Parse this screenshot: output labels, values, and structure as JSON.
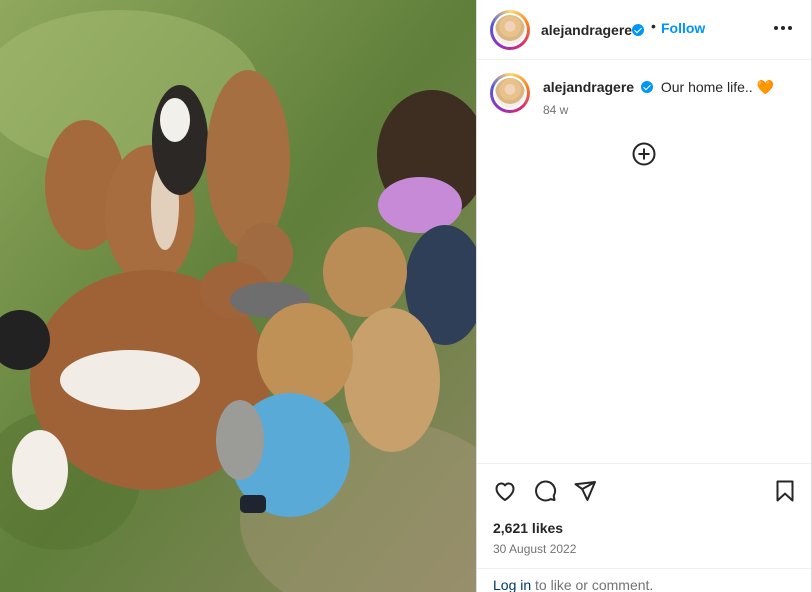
{
  "post": {
    "username": "alejandragere",
    "verified": true,
    "follow_label": "Follow",
    "separator": "•",
    "caption_text": "Our home life..",
    "caption_emoji": "🧡",
    "age": "84 w",
    "likes": "2,621 likes",
    "date": "30 August 2022"
  },
  "footer": {
    "login_link": "Log in",
    "login_suffix": " to like or comment."
  },
  "icons": {
    "more": "more-options-icon",
    "add": "add-circle-icon",
    "like": "heart-icon",
    "comment": "comment-icon",
    "share": "send-icon",
    "save": "bookmark-icon"
  },
  "colors": {
    "accent": "#0095f6",
    "text": "#262626",
    "muted": "#737373",
    "link": "#00376b",
    "emoji_heart": "#f97316"
  }
}
